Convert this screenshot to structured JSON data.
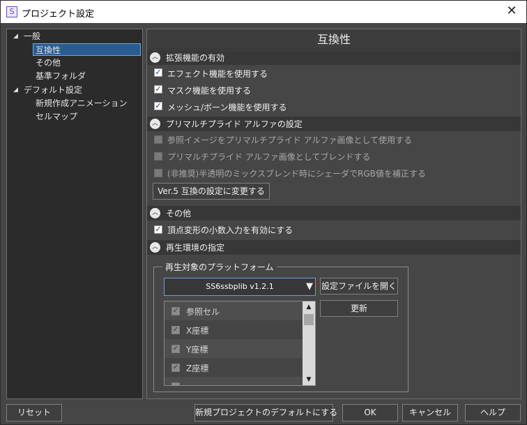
{
  "window": {
    "title": "プロジェクト設定",
    "icon_glyph": "S",
    "close_glyph": "✕"
  },
  "tree": {
    "groups": [
      {
        "label": "一般",
        "items": [
          "互換性",
          "その他",
          "基準フォルダ"
        ]
      },
      {
        "label": "デフォルト設定",
        "items": [
          "新規作成アニメーション",
          "セルマップ"
        ]
      }
    ],
    "selected": "互換性"
  },
  "panel": {
    "title": "互換性",
    "sections": {
      "extensions": {
        "label": "拡張機能の有効",
        "items": [
          {
            "label": "エフェクト機能を使用する",
            "checked": true
          },
          {
            "label": "マスク機能を使用する",
            "checked": true
          },
          {
            "label": "メッシュ/ボーン機能を使用する",
            "checked": true
          }
        ]
      },
      "premultiplied": {
        "label": "プリマルチプライド アルファの設定",
        "items": [
          {
            "label": "参照イメージをプリマルチプライド アルファ画像として使用する",
            "checked": false,
            "disabled": true
          },
          {
            "label": "プリマルチプライド アルファ画像としてブレンドする",
            "checked": false,
            "disabled": true
          },
          {
            "label": "(非推奨)半透明のミックスブレンド時にシェーダでRGB値を補正する",
            "checked": false,
            "disabled": true
          }
        ],
        "button": "Ver.5 互換の設定に変更する"
      },
      "other": {
        "label": "その他",
        "items": [
          {
            "label": "頂点変形の小数入力を有効にする",
            "checked": true
          }
        ]
      },
      "playback": {
        "label": "再生環境の指定",
        "group_label": "再生対象のプラットフォーム",
        "platform_selected": "SS6ssbplib v1.2.1",
        "open_settings_button": "設定ファイルを開く",
        "update_button": "更新",
        "list_items": [
          {
            "label": "参照セル",
            "checked": true
          },
          {
            "label": "X座標",
            "checked": true
          },
          {
            "label": "Y座標",
            "checked": true
          },
          {
            "label": "Z座標",
            "checked": true
          }
        ]
      }
    }
  },
  "footer": {
    "reset": "リセット",
    "make_default": "新規プロジェクトのデフォルトにする",
    "ok": "OK",
    "cancel": "キャンセル",
    "help": "ヘルプ"
  },
  "icons": {
    "collapse": "chevron-up-icon",
    "expand_tree": "triangle-down-icon",
    "check": "checkmark-icon"
  }
}
